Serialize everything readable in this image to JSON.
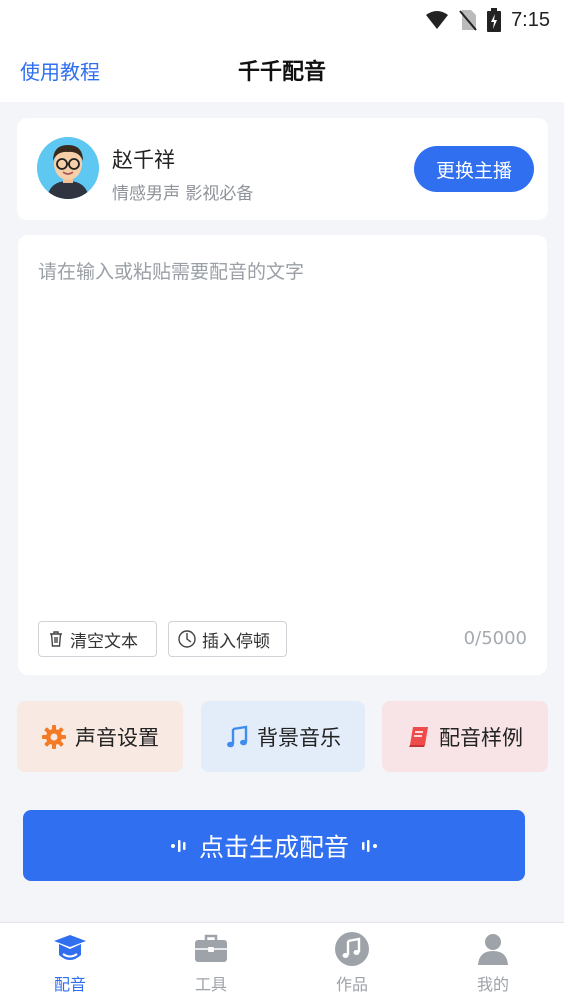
{
  "status_bar": {
    "time": "7:15",
    "icons": [
      "wifi-icon",
      "no-sim-icon",
      "battery-charging-icon"
    ]
  },
  "header": {
    "tutorial_link": "使用教程",
    "title": "千千配音"
  },
  "anchor": {
    "name": "赵千祥",
    "description": "情感男声 影视必备",
    "switch_label": "更换主播",
    "avatar_icon": "avatar-glasses-man"
  },
  "editor": {
    "placeholder": "请在输入或粘贴需要配音的文字",
    "clear_label": "清空文本",
    "pause_label": "插入停顿",
    "counter": "0/5000"
  },
  "features": [
    {
      "label": "声音设置",
      "icon": "gear-icon",
      "color": "#f47b26"
    },
    {
      "label": "背景音乐",
      "icon": "music-note-icon",
      "color": "#3f8cf0"
    },
    {
      "label": "配音样例",
      "icon": "book-icon",
      "color": "#ef4b4b"
    }
  ],
  "generate": {
    "label": "点击生成配音"
  },
  "tabs": [
    {
      "label": "配音",
      "icon": "mortarboard-icon",
      "active": true
    },
    {
      "label": "工具",
      "icon": "toolbox-icon",
      "active": false
    },
    {
      "label": "作品",
      "icon": "music-disc-icon",
      "active": false
    },
    {
      "label": "我的",
      "icon": "user-icon",
      "active": false
    }
  ],
  "colors": {
    "accent": "#2f6ff0",
    "background": "#f3f5f8"
  }
}
